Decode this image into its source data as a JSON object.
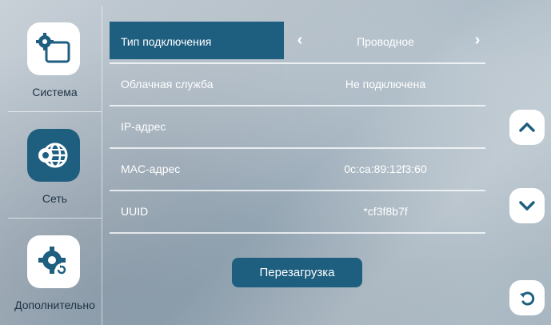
{
  "sidebar": {
    "items": [
      {
        "label": "Система",
        "icon": "system-settings-icon",
        "active": false
      },
      {
        "label": "Сеть",
        "icon": "network-globe-gear-icon",
        "active": true
      },
      {
        "label": "Дополнительно",
        "icon": "advanced-settings-icon",
        "active": false
      }
    ]
  },
  "network": {
    "rows": [
      {
        "title": "Тип подключения",
        "value": "Проводное",
        "selectable": true
      },
      {
        "title": "Облачная служба",
        "value": "Не подключена"
      },
      {
        "title": "IP-адрес",
        "value": ""
      },
      {
        "title": "MAC-адрес",
        "value": "0c:ca:89:12f3:60"
      },
      {
        "title": "UUID",
        "value": "*cf3f8b7f"
      }
    ],
    "reboot_label": "Перезагрузка"
  },
  "colors": {
    "accent": "#1e5f80",
    "text": "#ffffff"
  }
}
